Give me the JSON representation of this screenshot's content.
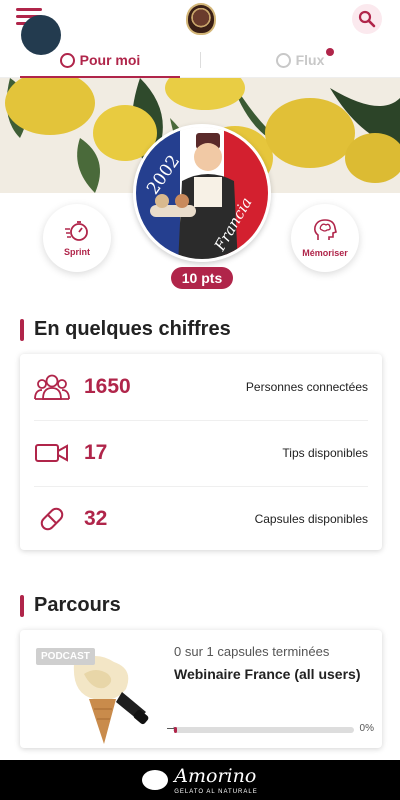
{
  "header": {
    "menu_icon": "hamburger-icon",
    "search_icon": "search-icon",
    "accent_color": "#b0254a"
  },
  "tabs": [
    {
      "label": "Pour moi",
      "icon": "user-circle-icon",
      "active": true
    },
    {
      "label": "Flux",
      "icon": "feed-icon",
      "active": false,
      "has_notification": true
    }
  ],
  "hero": {
    "character_year": "2002",
    "character_country": "Francia",
    "sprint_label": "Sprint",
    "memorize_label": "Mémoriser",
    "points": "10 pts"
  },
  "stats": {
    "title": "En quelques chiffres",
    "rows": [
      {
        "value": "1650",
        "label": "Personnes connectées",
        "icon": "people-icon"
      },
      {
        "value": "17",
        "label": "Tips disponibles",
        "icon": "video-icon"
      },
      {
        "value": "32",
        "label": "Capsules disponibles",
        "icon": "capsule-icon"
      }
    ]
  },
  "parcours": {
    "title": "Parcours",
    "badge": "PODCAST",
    "progress_text": "0 sur 1 capsules terminées",
    "course_title": "Webinaire France (all users)",
    "percent": "0%",
    "progress_fraction": 0
  },
  "footer": {
    "brand": "Amorino",
    "tagline": "GELATO AL NATURALE"
  }
}
